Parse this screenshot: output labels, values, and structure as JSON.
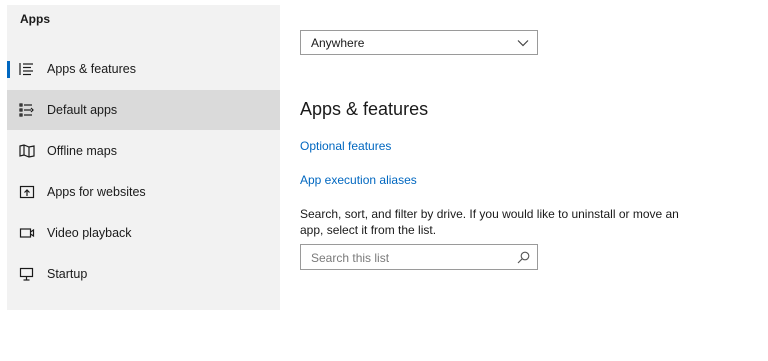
{
  "sidebar": {
    "title": "Apps",
    "items": [
      {
        "label": "Apps & features",
        "icon": "apps-list-icon",
        "selected": true
      },
      {
        "label": "Default apps",
        "icon": "default-apps-icon",
        "hovered": true
      },
      {
        "label": "Offline maps",
        "icon": "map-icon"
      },
      {
        "label": "Apps for websites",
        "icon": "open-in-browser-icon"
      },
      {
        "label": "Video playback",
        "icon": "video-icon"
      },
      {
        "label": "Startup",
        "icon": "startup-icon"
      }
    ]
  },
  "main": {
    "filter_dropdown": {
      "value": "Anywhere"
    },
    "section_title": "Apps & features",
    "links": {
      "optional_features": "Optional features",
      "app_execution_aliases": "App execution aliases"
    },
    "description": "Search, sort, and filter by drive. If you would like to uninstall or move an app, select it from the list.",
    "search": {
      "placeholder": "Search this list"
    }
  },
  "colors": {
    "accent": "#0067c0",
    "sidebar_bg": "#f2f2f2",
    "hover_bg": "#dadada",
    "link": "#0067c0"
  }
}
